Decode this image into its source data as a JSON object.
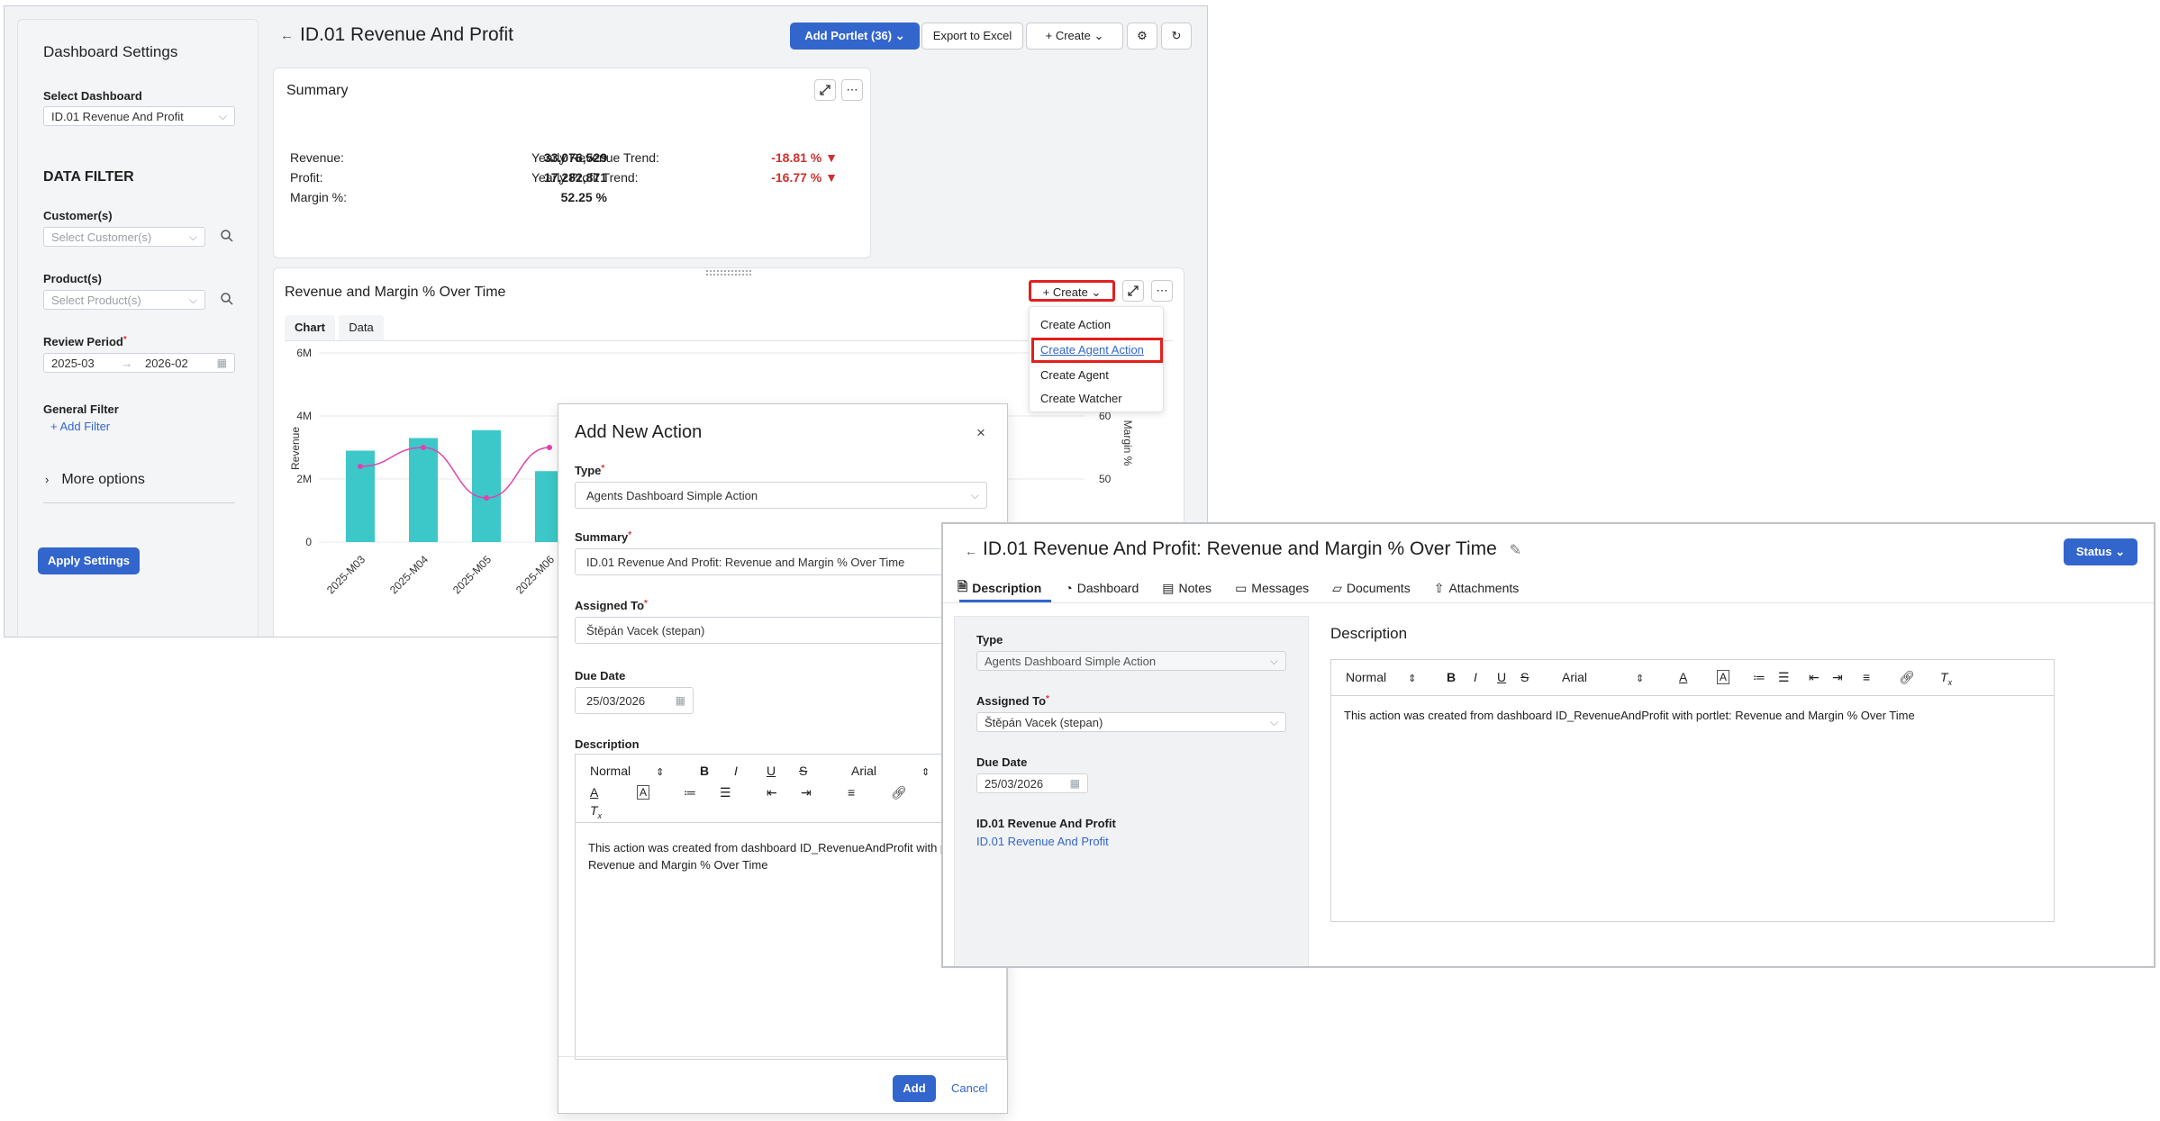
{
  "dashboard": {
    "title": "ID.01 Revenue And Profit",
    "add_portlet_label": "Add Portlet (36)",
    "export_label": "Export to Excel",
    "create_label": "Create"
  },
  "sidebar": {
    "title": "Dashboard Settings",
    "select_dashboard_label": "Select Dashboard",
    "select_dashboard_value": "ID.01 Revenue And Profit",
    "data_filter_heading": "DATA FILTER",
    "customers_label": "Customer(s)",
    "customers_placeholder": "Select Customer(s)",
    "products_label": "Product(s)",
    "products_placeholder": "Select Product(s)",
    "review_period_label": "Review Period",
    "review_period_from": "2025-03",
    "review_period_to": "2026-02",
    "general_filter_label": "General Filter",
    "add_filter_label": "Add Filter",
    "more_options_label": "More options",
    "apply_label": "Apply Settings"
  },
  "summary": {
    "title": "Summary",
    "rows": [
      {
        "label": "Revenue:",
        "value": "33,076,529"
      },
      {
        "label": "Profit:",
        "value": "17,282,871"
      },
      {
        "label": "Margin %:",
        "value": "52.25 %"
      }
    ],
    "trends": [
      {
        "label": "Yearly Revenue Trend:",
        "value": "-18.81 %"
      },
      {
        "label": "Yearly Profit Trend:",
        "value": "-16.77 %"
      }
    ]
  },
  "chart_portlet": {
    "title": "Revenue and Margin % Over Time",
    "create_label": "Create",
    "tabs": [
      "Chart",
      "Data"
    ],
    "menu_items": [
      "Create Action",
      "Create Agent Action",
      "Create Agent",
      "Create Watcher"
    ]
  },
  "chart_data": {
    "type": "bar",
    "categories": [
      "2025-M03",
      "2025-M04",
      "2025-M05",
      "2025-M06"
    ],
    "ylabel": "Revenue",
    "y2label": "Margin %",
    "y_ticks": [
      "0",
      "2M",
      "4M",
      "6M"
    ],
    "y2_ticks": [
      "50",
      "60"
    ],
    "ylim": [
      0,
      6000000
    ],
    "series": [
      {
        "type": "bar",
        "values": [
          2900000,
          3300000,
          3550000,
          2250000
        ]
      },
      {
        "type": "line",
        "values": [
          52,
          55,
          47,
          55
        ]
      }
    ]
  },
  "dialog": {
    "title": "Add New Action",
    "type_label": "Type",
    "type_value": "Agents Dashboard Simple Action",
    "summary_label": "Summary",
    "summary_value": "ID.01 Revenue And Profit: Revenue and Margin % Over Time",
    "assigned_label": "Assigned To",
    "assigned_value": "Štěpán Vacek (stepan)",
    "due_label": "Due Date",
    "due_value": "25/03/2026",
    "description_label": "Description",
    "editor_style": "Normal",
    "editor_font": "Arial",
    "description_text": "This action was created from dashboard ID_RevenueAndProfit with portlet: Revenue and Margin % Over Time",
    "add_label": "Add",
    "cancel_label": "Cancel"
  },
  "detail": {
    "title": "ID.01 Revenue And Profit: Revenue and Margin % Over Time",
    "status_label": "Status",
    "tabs": [
      "Description",
      "Dashboard",
      "Notes",
      "Messages",
      "Documents",
      "Attachments"
    ],
    "type_label": "Type",
    "type_value": "Agents Dashboard Simple Action",
    "assigned_label": "Assigned To",
    "assigned_value": "Štěpán Vacek (stepan)",
    "due_label": "Due Date",
    "due_value": "25/03/2026",
    "dashboard_label": "ID.01 Revenue And Profit",
    "dashboard_link": "ID.01 Revenue And Profit",
    "description_heading": "Description",
    "editor_style": "Normal",
    "editor_font": "Arial",
    "description_text": "This action was created from dashboard ID_RevenueAndProfit with portlet: Revenue and Margin % Over Time"
  },
  "colors": {
    "accent": "#3366cc",
    "bar": "#3cc8c8",
    "line": "#e040b0",
    "negative": "#d03030",
    "highlight": "#e02020"
  }
}
